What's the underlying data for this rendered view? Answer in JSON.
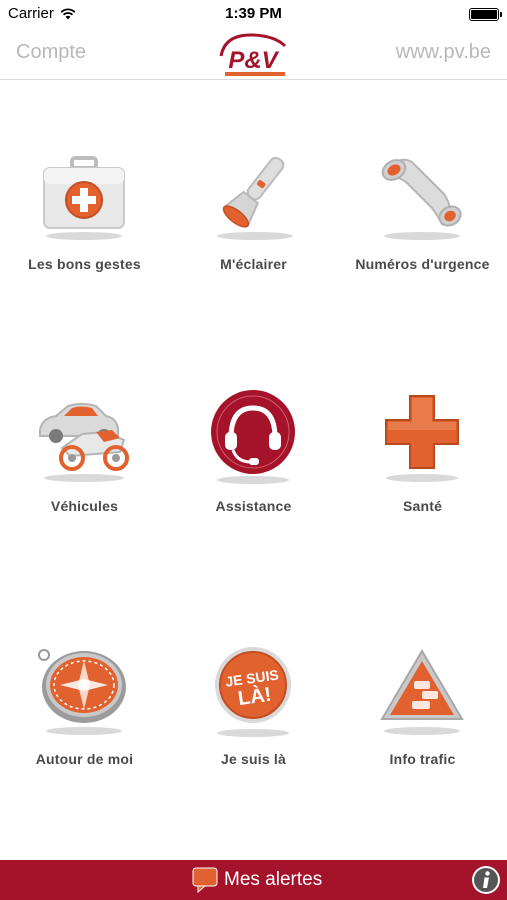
{
  "status_bar": {
    "carrier": "Carrier",
    "time": "1:39 PM",
    "wifi_icon": "wifi-icon",
    "battery_icon": "battery-icon"
  },
  "nav": {
    "left_label": "Compte",
    "right_label": "www.pv.be",
    "logo_text": "P&V",
    "muted_color": "#b8b8b8"
  },
  "tiles": [
    {
      "label": "Les bons gestes",
      "icon": "first-aid-kit-icon"
    },
    {
      "label": "M'éclairer",
      "icon": "flashlight-icon"
    },
    {
      "label": "Numéros d'urgence",
      "icon": "telephone-handset-icon"
    },
    {
      "label": "Véhicules",
      "icon": "car-motorcycle-icon"
    },
    {
      "label": "Assistance",
      "icon": "headset-icon"
    },
    {
      "label": "Santé",
      "icon": "medical-cross-icon"
    },
    {
      "label": "Autour de moi",
      "icon": "compass-icon"
    },
    {
      "label": "Je suis là",
      "icon": "je-suis-la-badge-icon",
      "badge_text": "JE SUIS LÀ!"
    },
    {
      "label": "Info trafic",
      "icon": "traffic-warning-icon"
    }
  ],
  "bottom_bar": {
    "alerts_label": "Mes alertes",
    "alerts_icon": "speech-bubble-icon",
    "info_icon": "info-icon",
    "background": "#a5132b"
  },
  "colors": {
    "brand_red": "#a5132b",
    "accent_orange": "#e2622f"
  }
}
